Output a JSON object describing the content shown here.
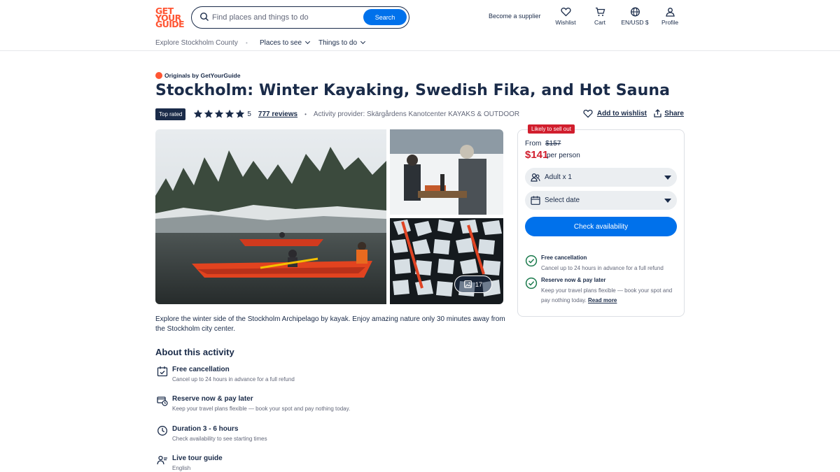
{
  "header": {
    "logo_lines": [
      "GET",
      "YOUR",
      "GUIDE"
    ],
    "search_placeholder": "Find places and things to do",
    "search_button": "Search",
    "become_supplier": "Become a supplier",
    "icons": [
      {
        "label": "Wishlist",
        "icon": "heart-icon"
      },
      {
        "label": "Cart",
        "icon": "cart-icon"
      },
      {
        "label": "EN/USD $",
        "icon": "globe-icon"
      },
      {
        "label": "Profile",
        "icon": "profile-icon"
      }
    ]
  },
  "subnav": {
    "breadcrumb": "Explore Stockholm County",
    "items": [
      "Places to see",
      "Things to do"
    ]
  },
  "activity": {
    "originals": "Originals by GetYourGuide",
    "title": "Stockholm: Winter Kayaking, Swedish Fika, and Hot Sauna",
    "badge": "Top rated",
    "rating_value": 5,
    "rating": "5",
    "reviews": "777 reviews",
    "provider": "Activity provider: Skärgårdens Kanotcenter KAYAKS & OUTDOOR",
    "add_wishlist": "Add to wishlist",
    "share": "Share",
    "photo_count": "17",
    "description": "Explore the winter side of the Stockholm Archipelago by kayak. Enjoy amazing nature only 30 minutes away from the Stockholm city center."
  },
  "about": {
    "title": "About this activity",
    "features": [
      {
        "title": "Free cancellation",
        "subtitle": "Cancel up to 24 hours in advance for a full refund",
        "icon": "calendar-check-icon"
      },
      {
        "title": "Reserve now & pay later",
        "subtitle": "Keep your travel plans flexible — book your spot and pay nothing today.",
        "icon": "card-clock-icon"
      },
      {
        "title": "Duration 3 - 6 hours",
        "subtitle": "Check availability to see starting times",
        "icon": "clock-icon"
      },
      {
        "title": "Live tour guide",
        "subtitle": "English",
        "icon": "guide-icon"
      }
    ]
  },
  "booking": {
    "likely": "Likely to sell out",
    "from": "From",
    "old_price": "$157",
    "price": "$141",
    "per": "per person",
    "participants": "Adult x 1",
    "date": "Select date",
    "cta": "Check availability",
    "features": [
      {
        "title": "Free cancellation",
        "subtitle": "Cancel up to 24 hours in advance for a full refund"
      },
      {
        "title": "Reserve now & pay later",
        "subtitle": "Keep your travel plans flexible — book your spot and pay nothing today.",
        "link": "Read more"
      }
    ]
  },
  "colors": {
    "brand": "#ff5533",
    "primary": "#0071eb",
    "text": "#1a2b49",
    "sale": "#d11e2d",
    "check": "#1a7a4c"
  }
}
